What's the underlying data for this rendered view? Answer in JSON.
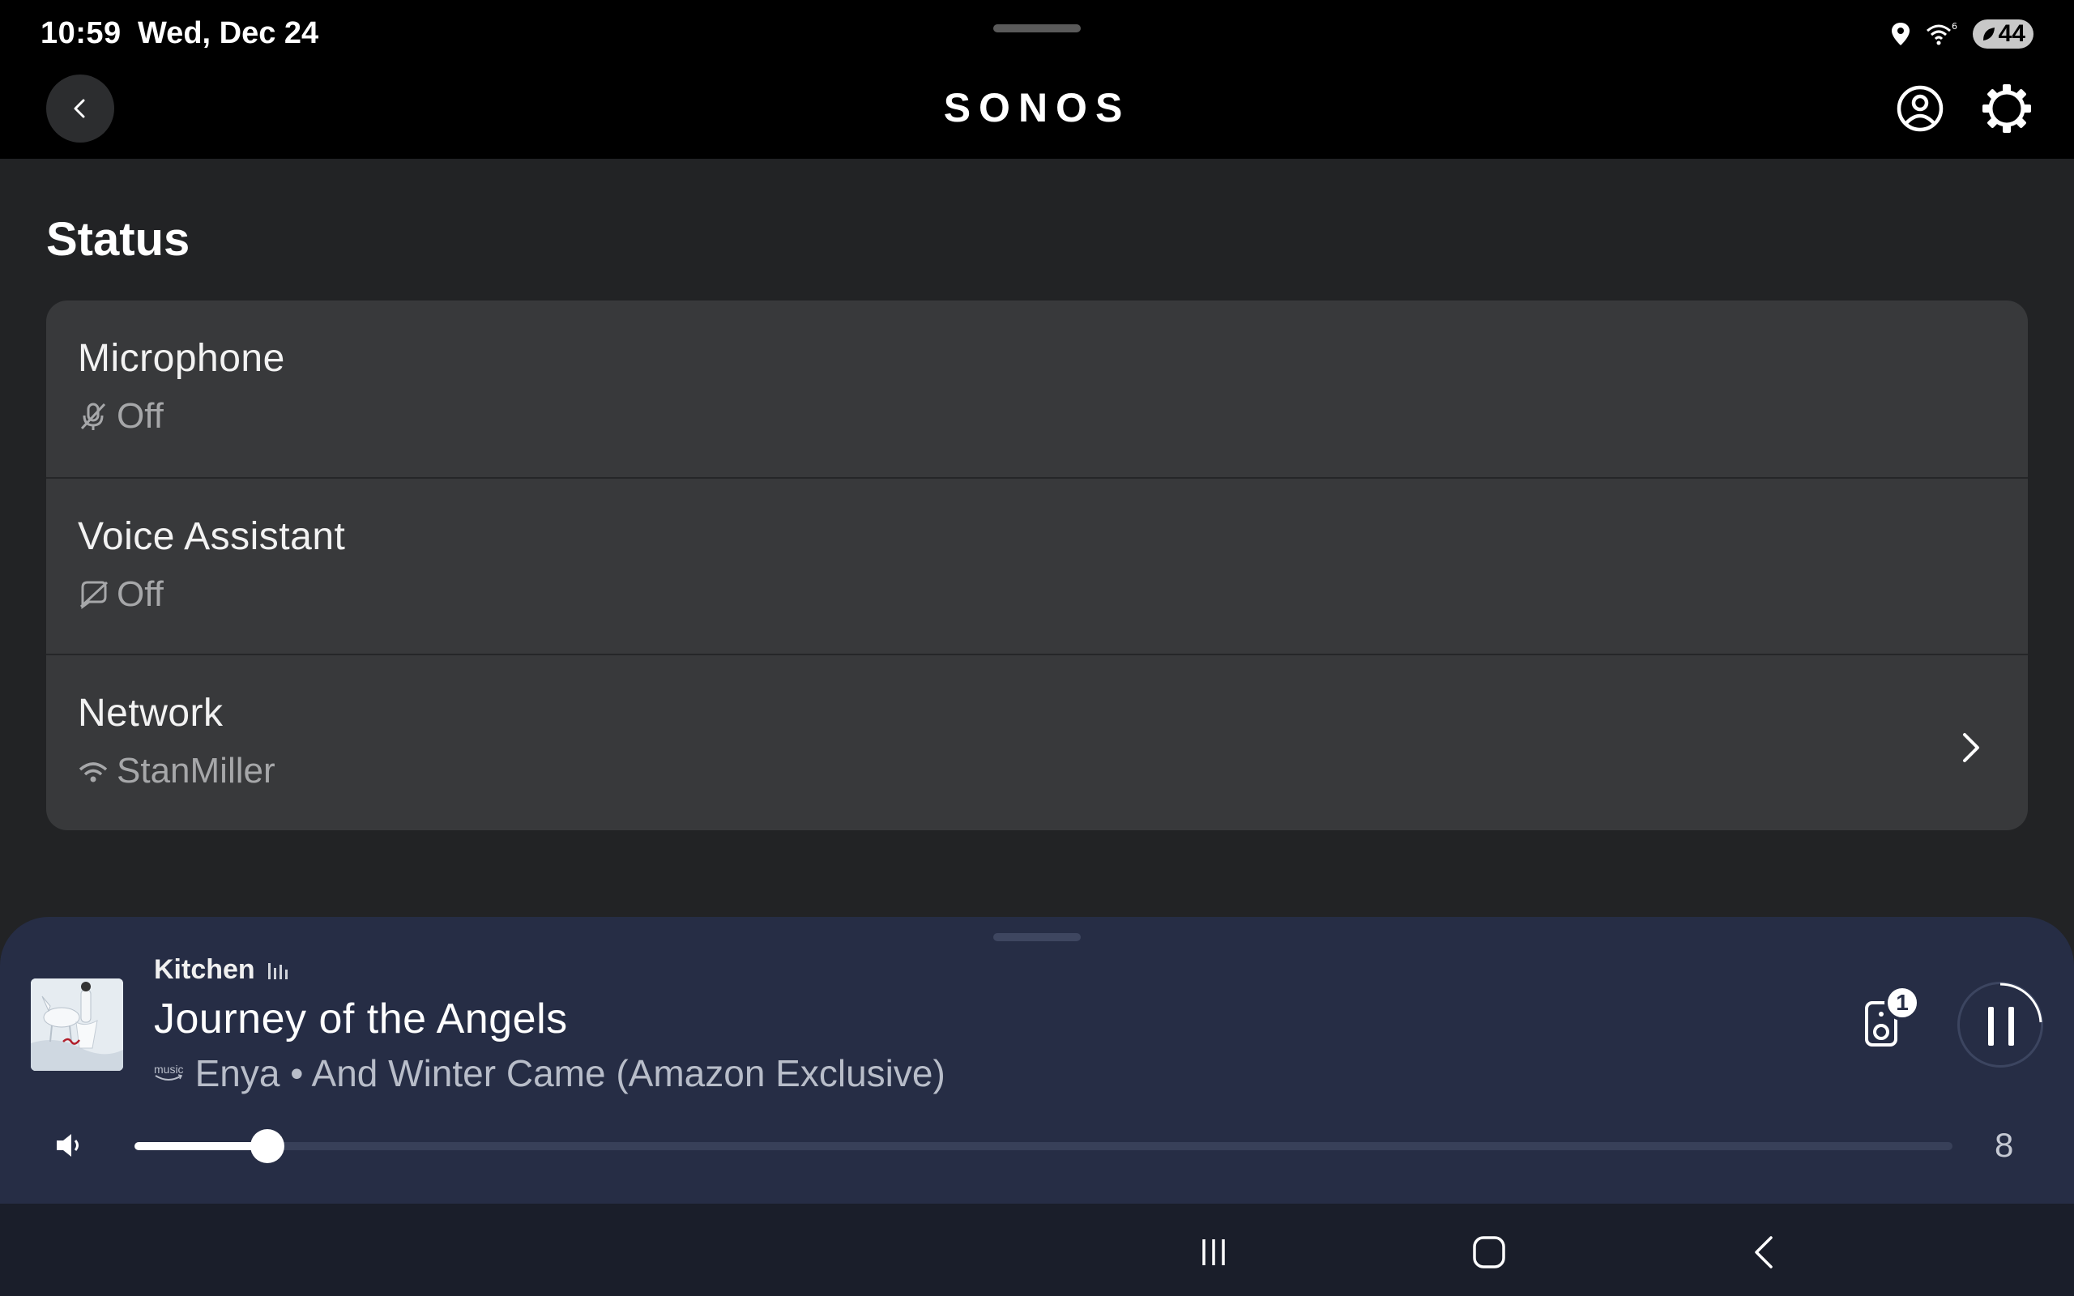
{
  "status_bar": {
    "time": "10:59",
    "date": "Wed, Dec 24",
    "battery": "44",
    "icons": [
      "location-icon",
      "wifi-6-icon",
      "battery-saver-icon"
    ]
  },
  "header": {
    "logo": "SONOS",
    "icons": [
      "back-icon",
      "account-icon",
      "settings-icon"
    ]
  },
  "main": {
    "section_title": "Status",
    "rows": [
      {
        "label": "Microphone",
        "value": "Off",
        "icon": "mic-off-icon"
      },
      {
        "label": "Voice Assistant",
        "value": "Off",
        "icon": "voice-assistant-off-icon"
      },
      {
        "label": "Network",
        "value": "StanMiller",
        "icon": "wifi-icon",
        "chevron": true
      }
    ]
  },
  "player": {
    "room": "Kitchen",
    "track": "Journey of the Angels",
    "source_logo": "music",
    "artist_album": "Enya • And Winter Came (Amazon Exclusive)",
    "group_count": "1",
    "volume": 8,
    "volume_fraction": 0.073,
    "colors": {
      "background": "#262d45",
      "accent": "#ffffff"
    }
  },
  "nav": {
    "icons": [
      "recents-icon",
      "home-icon",
      "back-nav-icon"
    ]
  }
}
